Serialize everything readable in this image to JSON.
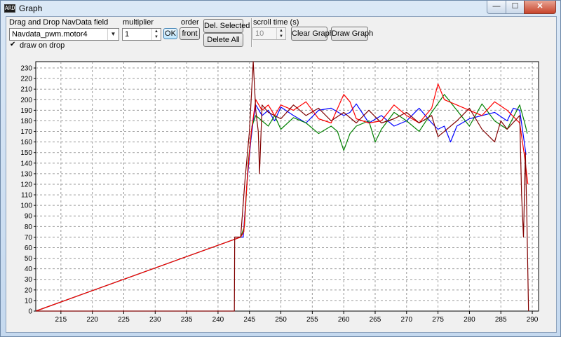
{
  "window": {
    "title": "Graph",
    "icon": "app-icon",
    "icon_glyph": "ARD",
    "controls": {
      "minimize": "—",
      "maximize": "☐",
      "close": "✕"
    }
  },
  "toolbar": {
    "field_label": "Drag and Drop NavData field",
    "field_value": "Navdata_pwm.motor4",
    "draw_on_drop_label": "draw on drop",
    "draw_on_drop_checked": true,
    "multiplier_label": "multiplier",
    "multiplier_value": "1",
    "ok_label": "OK",
    "order_label": "order",
    "order_button_label": "front",
    "del_selected_label": "Del. Selected",
    "delete_all_label": "Delete All",
    "scroll_time_label": "scroll time (s)",
    "scroll_time_value": "10",
    "clear_graph_label": "Clear Graph",
    "draw_graph_label": "Draw Graph"
  },
  "chart_data": {
    "type": "line",
    "xlim": [
      211,
      291
    ],
    "ylim": [
      0,
      236
    ],
    "x_ticks": [
      "215",
      "220",
      "225",
      "230",
      "235",
      "240",
      "245",
      "250",
      "255",
      "260",
      "265",
      "270",
      "275",
      "280",
      "285",
      "290"
    ],
    "y_ticks": [
      "0",
      "10",
      "20",
      "30",
      "40",
      "50",
      "60",
      "70",
      "80",
      "90",
      "100",
      "110",
      "120",
      "130",
      "140",
      "150",
      "160",
      "170",
      "180",
      "190",
      "200",
      "210",
      "220",
      "230"
    ],
    "grid": true,
    "colors": {
      "series_1": "#0000ff",
      "series_2": "#008000",
      "series_3": "#ff0000",
      "series_4": "#800000"
    },
    "series": [
      {
        "color": "#0000ff",
        "x": [
          211,
          243.6,
          244.0,
          244.6,
          245.2,
          245.6,
          246,
          247,
          248,
          249,
          250,
          252,
          254,
          256,
          258,
          260,
          261,
          262,
          264,
          266,
          268,
          270,
          272,
          274,
          275,
          276,
          277,
          278,
          280,
          282,
          284,
          286,
          287,
          288,
          288.6,
          289.0
        ],
        "y": [
          0,
          70,
          70,
          120,
          160,
          180,
          195,
          185,
          190,
          180,
          193,
          185,
          178,
          190,
          192,
          185,
          188,
          196,
          178,
          185,
          175,
          180,
          192,
          178,
          172,
          175,
          160,
          175,
          182,
          185,
          188,
          180,
          192,
          190,
          165,
          148
        ]
      },
      {
        "color": "#008000",
        "x": [
          211,
          243.6,
          244.2,
          244.8,
          245.4,
          246,
          247,
          248,
          249,
          250,
          252,
          254,
          256,
          258,
          259,
          260,
          261,
          262,
          264,
          265,
          266,
          268,
          270,
          272,
          274,
          276,
          278,
          280,
          282,
          284,
          286,
          288,
          288.8,
          289.2
        ],
        "y": [
          0,
          70,
          80,
          140,
          175,
          185,
          180,
          175,
          185,
          172,
          183,
          178,
          168,
          175,
          170,
          152,
          168,
          175,
          180,
          160,
          172,
          188,
          180,
          170,
          188,
          205,
          190,
          175,
          196,
          180,
          172,
          195,
          178,
          168
        ]
      },
      {
        "color": "#ff0000",
        "x": [
          211,
          243.6,
          244.1,
          244.7,
          245.3,
          246,
          247,
          248,
          249,
          250,
          252,
          254,
          256,
          258,
          260,
          261,
          262,
          264,
          266,
          268,
          270,
          272,
          274,
          275,
          276,
          278,
          280,
          282,
          284,
          286,
          288,
          288.8,
          289.3
        ],
        "y": [
          0,
          70,
          75,
          130,
          170,
          200,
          190,
          195,
          185,
          195,
          190,
          198,
          182,
          178,
          205,
          198,
          182,
          178,
          180,
          195,
          185,
          178,
          192,
          215,
          200,
          195,
          190,
          185,
          198,
          190,
          178,
          145,
          120
        ]
      },
      {
        "color": "#800000",
        "x": [
          211,
          242.6,
          242.65,
          243.6,
          244.3,
          245.0,
          245.6,
          246.0,
          246.4,
          246.6,
          247,
          248,
          250,
          252,
          254,
          256,
          258,
          260,
          262,
          264,
          266,
          268,
          270,
          272,
          274,
          275,
          276,
          278,
          280,
          282,
          284,
          285,
          286,
          288,
          288.3,
          288.6,
          288.9,
          289.1,
          289.4
        ],
        "y": [
          0,
          0,
          70,
          70,
          125,
          170,
          236,
          190,
          170,
          130,
          195,
          188,
          182,
          195,
          185,
          192,
          180,
          188,
          178,
          190,
          178,
          182,
          188,
          178,
          185,
          165,
          170,
          180,
          192,
          172,
          160,
          180,
          172,
          185,
          110,
          70,
          150,
          100,
          0
        ]
      }
    ]
  }
}
